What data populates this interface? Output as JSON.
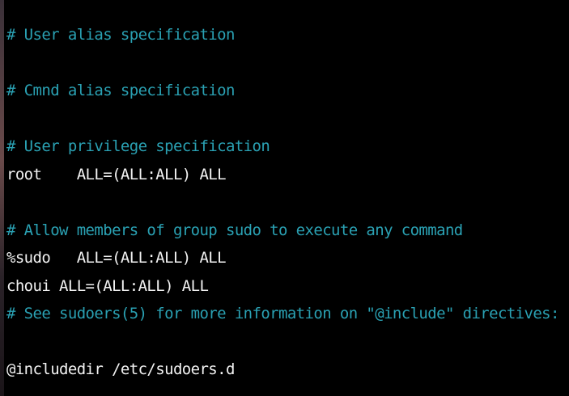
{
  "colors": {
    "background": "#000000",
    "comment": "#2aa1b3",
    "text": "#f2f2f2"
  },
  "lines": [
    {
      "text": "# User alias specification",
      "kind": "comment"
    },
    {
      "text": "",
      "kind": "blank"
    },
    {
      "text": "# Cmnd alias specification",
      "kind": "comment"
    },
    {
      "text": "",
      "kind": "blank"
    },
    {
      "text": "# User privilege specification",
      "kind": "comment"
    },
    {
      "text": "root    ALL=(ALL:ALL) ALL",
      "kind": "plain"
    },
    {
      "text": "",
      "kind": "blank"
    },
    {
      "text": "# Allow members of group sudo to execute any command",
      "kind": "comment"
    },
    {
      "text": "%sudo   ALL=(ALL:ALL) ALL",
      "kind": "plain"
    },
    {
      "text": "choui ALL=(ALL:ALL) ALL",
      "kind": "plain"
    },
    {
      "text": "# See sudoers(5) for more information on \"@include\" directives:",
      "kind": "comment"
    },
    {
      "text": "",
      "kind": "blank"
    },
    {
      "text": "@includedir /etc/sudoers.d",
      "kind": "plain"
    }
  ]
}
